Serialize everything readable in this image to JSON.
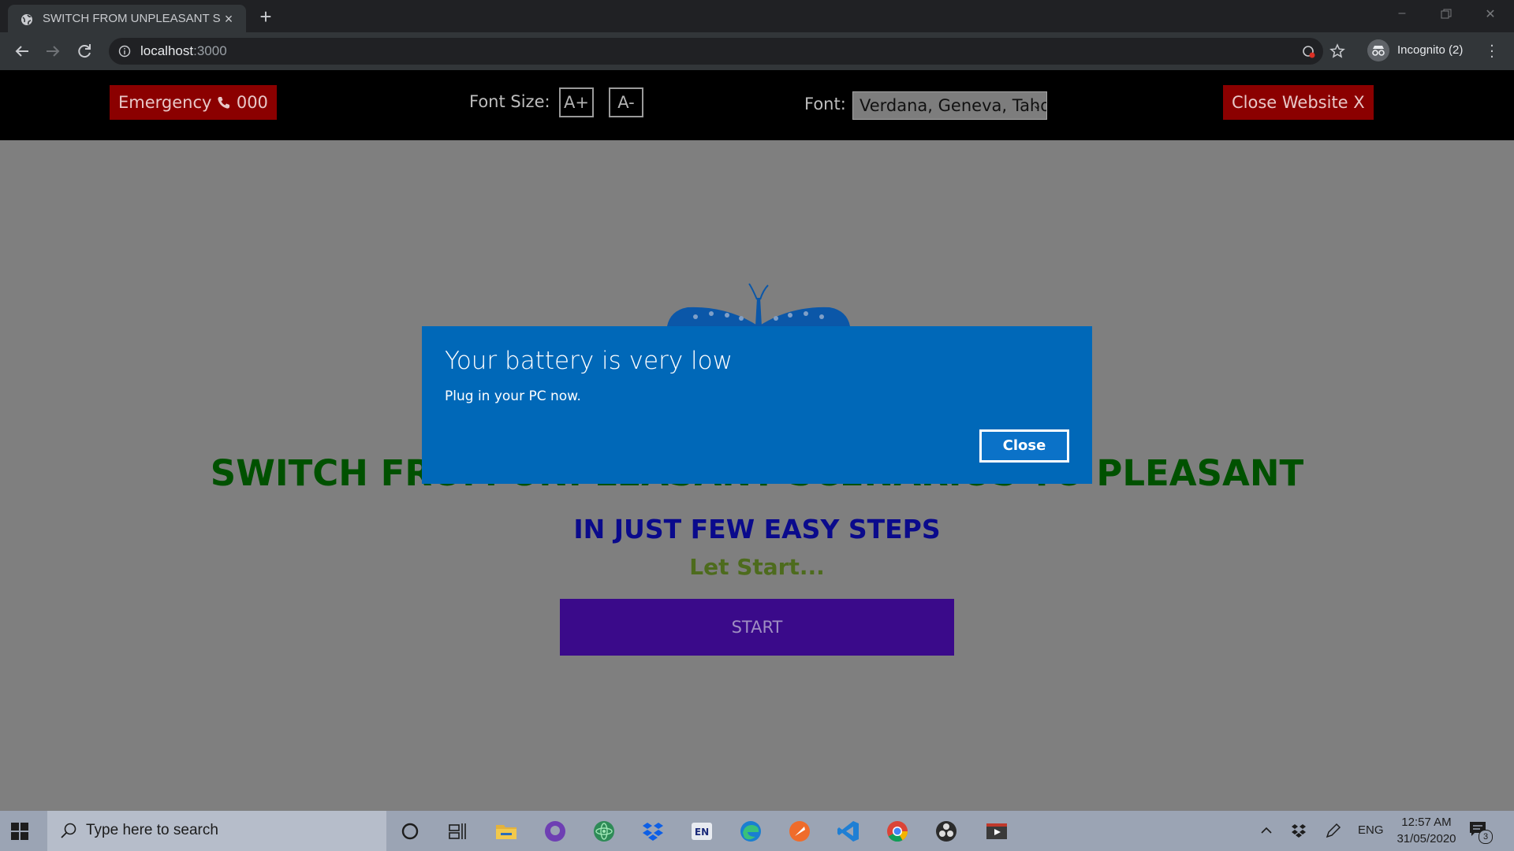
{
  "browser": {
    "tab_title": "SWITCH FROM UNPLEASANT SCENARIOS TO PLEASANT",
    "url_host": "localhost",
    "url_port": ":3000",
    "profile_label": "Incognito (2)"
  },
  "site": {
    "emergency_label": "Emergency",
    "emergency_number": "000",
    "font_size_label": "Font Size:",
    "font_increase": "A+",
    "font_decrease": "A-",
    "font_label": "Font:",
    "font_selected": "Verdana, Geneva, Tahoma, sans-serif",
    "close_website_label": "Close Website X",
    "headline": "SWITCH FROM UNPLEASANT SCENARIOS TO PLEASANT",
    "subheadline": "IN JUST FEW EASY STEPS",
    "lets_start": "Let Start...",
    "start_button": "START",
    "colors": {
      "header_bg": "#000000",
      "red_button": "#8b0000",
      "headline": "#005100",
      "subheadline": "#0a0a8c",
      "start_button": "#3a0a8a"
    }
  },
  "toast": {
    "title": "Your battery is very low",
    "message": "Plug in your PC now.",
    "close_label": "Close",
    "bg_color": "#0068b8"
  },
  "taskbar": {
    "search_placeholder": "Type here to search",
    "language": "ENG",
    "time": "12:57 AM",
    "date": "31/05/2020",
    "notification_count": "3",
    "pinned": [
      "cortana-icon",
      "task-view-icon",
      "file-explorer-icon",
      "github-desktop-icon",
      "atom-icon",
      "dropbox-icon",
      "language-en-icon",
      "edge-icon",
      "postman-icon",
      "vscode-icon",
      "chrome-icon",
      "obs-icon",
      "video-editor-icon"
    ]
  }
}
